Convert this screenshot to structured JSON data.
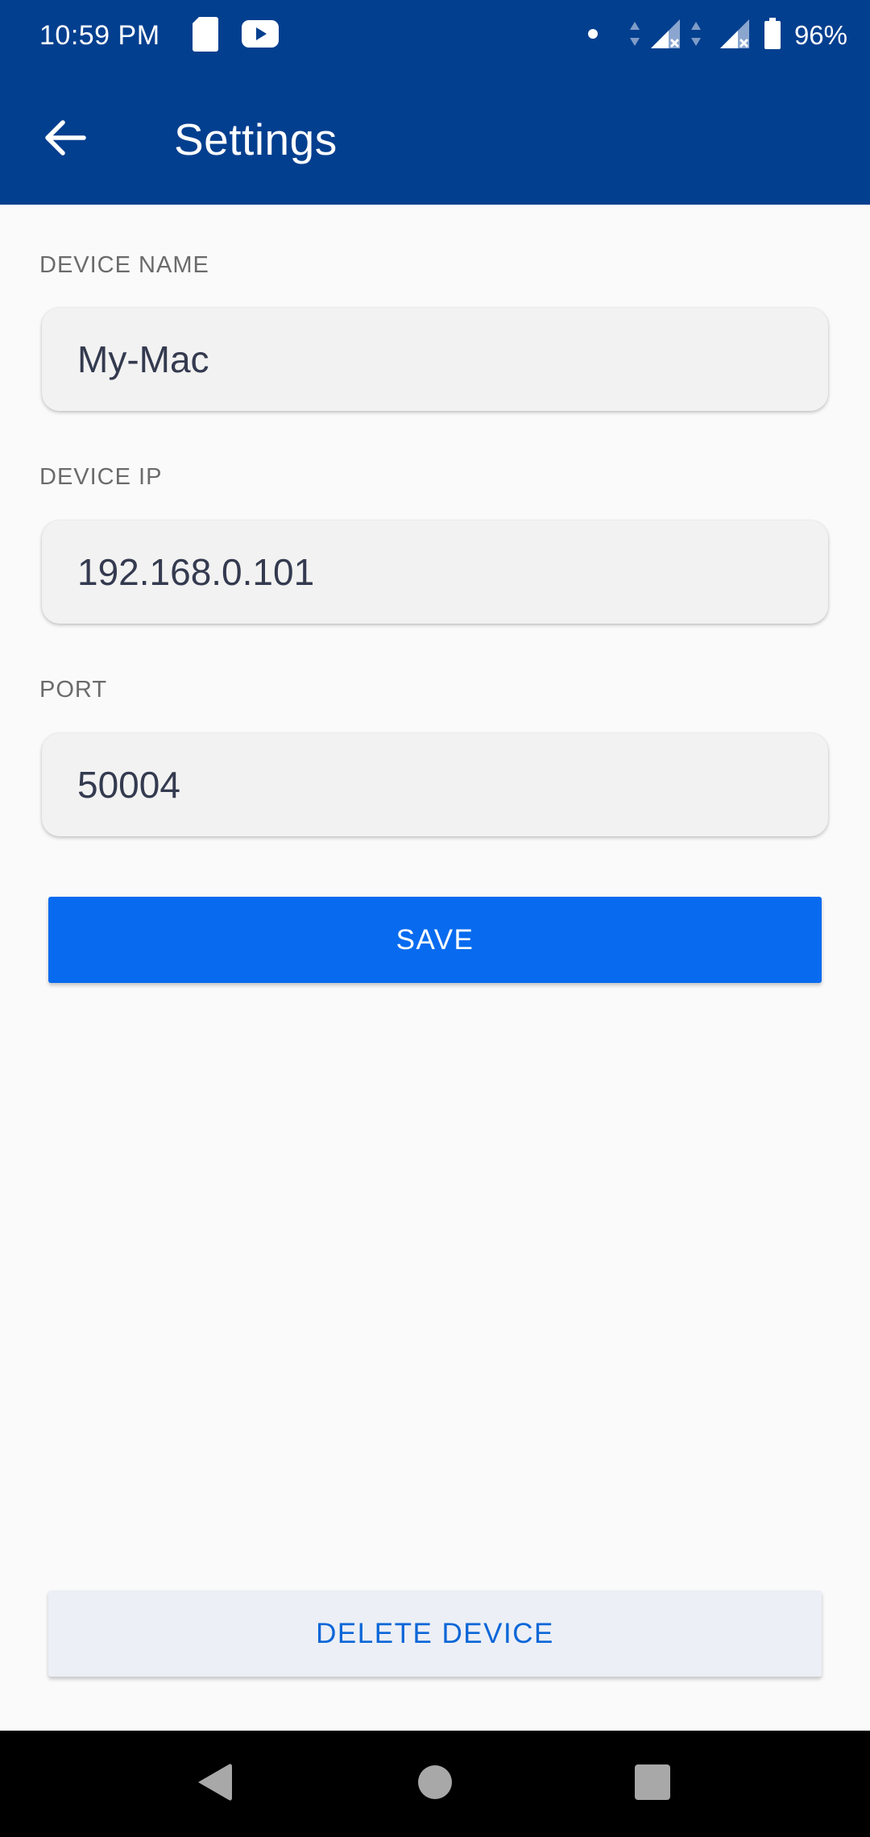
{
  "status_bar": {
    "time": "10:59 PM",
    "battery": "96%",
    "icons": [
      "sim-card-icon",
      "youtube-icon",
      "dot-icon",
      "data-arrows-icon",
      "signal-icon",
      "signal-icon",
      "battery-icon"
    ]
  },
  "app_bar": {
    "title": "Settings",
    "back_icon": "arrow-left-icon"
  },
  "form": {
    "device_name": {
      "label": "DEVICE NAME",
      "value": "My-Mac"
    },
    "device_ip": {
      "label": "DEVICE IP",
      "value": "192.168.0.101"
    },
    "port": {
      "label": "PORT",
      "value": "50004"
    }
  },
  "actions": {
    "save_label": "SAVE",
    "delete_label": "DELETE DEVICE"
  },
  "colors": {
    "app_bar": "#033f8f",
    "primary_button": "#086bef",
    "delete_text": "#0a66d8",
    "delete_background": "#eceff5",
    "background": "#fafafa"
  },
  "nav_bar": {
    "icons": [
      "back-triangle-icon",
      "home-circle-icon",
      "recents-square-icon"
    ]
  }
}
